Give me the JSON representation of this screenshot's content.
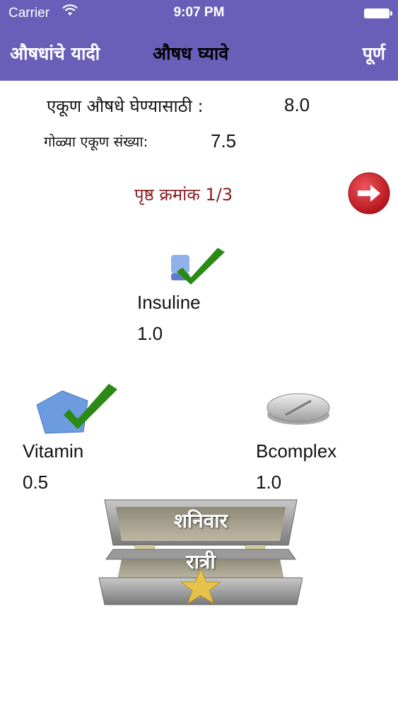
{
  "status_bar": {
    "carrier": "Carrier",
    "time": "9:07 PM"
  },
  "nav": {
    "left": "औषधांचे यादी",
    "title": "औषध घ्यावे",
    "right": "पूर्ण"
  },
  "summary": {
    "total_label": "एकूण औषधे घेण्यासाठी :",
    "total_value": "8.0",
    "count_label": "गोळ्या एकूण संख्या:",
    "count_value": "7.5"
  },
  "page": {
    "label": "पृष्ठ क्रमांक 1/3"
  },
  "medicines": [
    {
      "name": "Insuline",
      "qty": "1.0",
      "icon": "injection-icon",
      "taken": true
    },
    {
      "name": "Vitamin",
      "qty": "0.5",
      "icon": "pentagon-pill-icon",
      "taken": true
    },
    {
      "name": "Bcomplex",
      "qty": "1.0",
      "icon": "oval-tablet-icon",
      "taken": false
    }
  ],
  "pillbox": {
    "day": "शनिवार",
    "time_of_day": "रात्री"
  },
  "colors": {
    "nav_bg": "#6a5fb8",
    "page_label": "#8b1c22",
    "next_button": "#d8242c",
    "check": "#2a8a14"
  }
}
